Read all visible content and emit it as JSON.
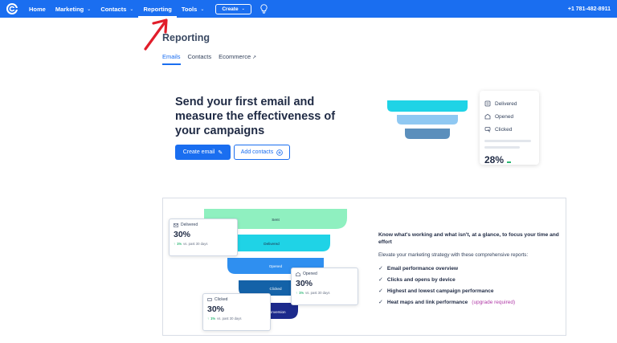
{
  "nav": {
    "items": [
      {
        "label": "Home",
        "chevron": false,
        "active": false
      },
      {
        "label": "Marketing",
        "chevron": true,
        "active": false
      },
      {
        "label": "Contacts",
        "chevron": true,
        "active": false
      },
      {
        "label": "Reporting",
        "chevron": false,
        "active": true
      },
      {
        "label": "Tools",
        "chevron": true,
        "active": false
      }
    ],
    "create_label": "Create",
    "phone": "+1 781-482-8911",
    "bg_color": "#1a6ef0"
  },
  "page": {
    "title": "Reporting",
    "tabs": [
      {
        "label": "Emails",
        "active": true
      },
      {
        "label": "Contacts",
        "active": false
      },
      {
        "label": "Ecommerce",
        "active": false
      }
    ]
  },
  "hero": {
    "title": "Send your first email and measure the effectiveness of your campaigns",
    "create_email_label": "Create email",
    "add_contacts_label": "Add contacts",
    "legend": {
      "delivered": "Delivered",
      "opened": "Opened",
      "clicked": "Clicked",
      "percent": "28%"
    }
  },
  "panel": {
    "funnel": {
      "sent": "Sent",
      "delivered": "Delivered",
      "opened": "Opened",
      "clicked": "Clicked",
      "conversion": "Conversion"
    },
    "cards": {
      "delivered": {
        "label": "Delivered",
        "value": "30%",
        "trend_up": "1%",
        "trend_text": "vs. past 30 days"
      },
      "opened": {
        "label": "Opened",
        "value": "30%",
        "trend_up": "1%",
        "trend_text": "vs. past 30 days"
      },
      "clicked": {
        "label": "Clicked",
        "value": "30%",
        "trend_up": "1%",
        "trend_text": "vs. past 30 days"
      }
    },
    "info": {
      "heading": "Know what's working and what isn't, at a glance, to focus your time and effort",
      "subheading": "Elevate your marketing strategy with these comprehensive reports:",
      "items": [
        "Email performance overview",
        "Clicks and opens by device",
        "Highest and lowest campaign performance",
        "Heat maps and link performance"
      ],
      "upgrade": "(upgrade required)"
    }
  }
}
